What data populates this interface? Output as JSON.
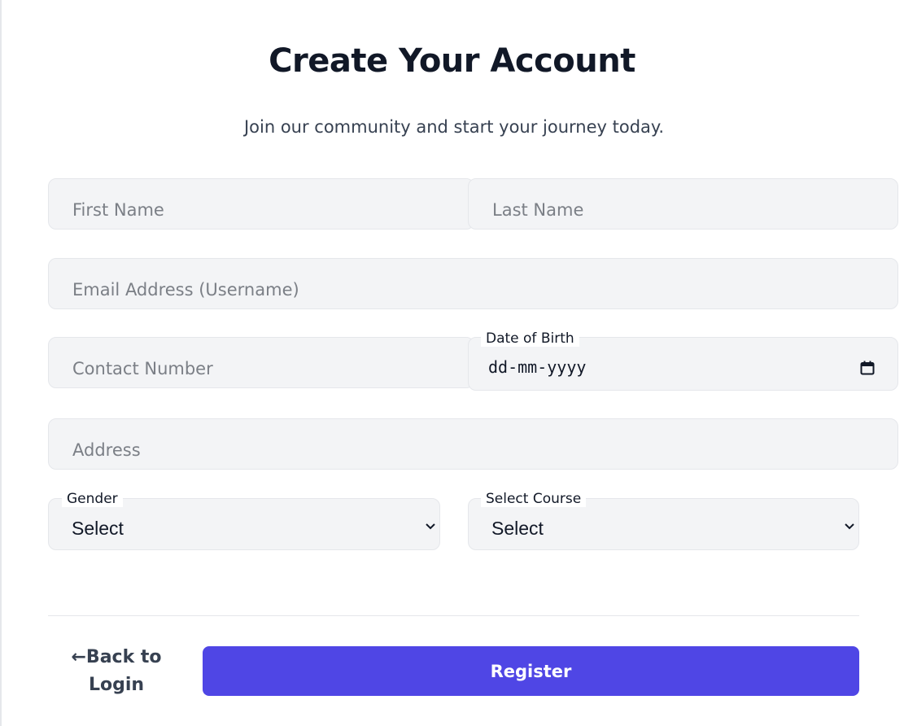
{
  "header": {
    "title": "Create Your Account",
    "subtitle": "Join our community and start your journey today."
  },
  "form": {
    "first_name": {
      "placeholder": "First Name",
      "value": ""
    },
    "last_name": {
      "placeholder": "Last Name",
      "value": ""
    },
    "email": {
      "placeholder": "Email Address (Username)",
      "value": ""
    },
    "contact": {
      "placeholder": "Contact Number",
      "value": ""
    },
    "dob": {
      "label": "Date of Birth",
      "value": "dd-mm-yyyy"
    },
    "address": {
      "placeholder": "Address",
      "value": ""
    },
    "gender": {
      "label": "Gender",
      "selected": "Select"
    },
    "course": {
      "label": "Select Course",
      "selected": "Select"
    }
  },
  "actions": {
    "back_arrow": "←",
    "back_line1": "Back to",
    "back_line2": "Login",
    "register_label": "Register"
  },
  "icons": {
    "date": "calendar-icon",
    "select": "chevron-down-icon"
  },
  "colors": {
    "primary": "#4f46e5",
    "field_bg": "#f3f4f6",
    "field_border": "#e5e7eb",
    "title": "#111827",
    "muted": "#374151"
  }
}
